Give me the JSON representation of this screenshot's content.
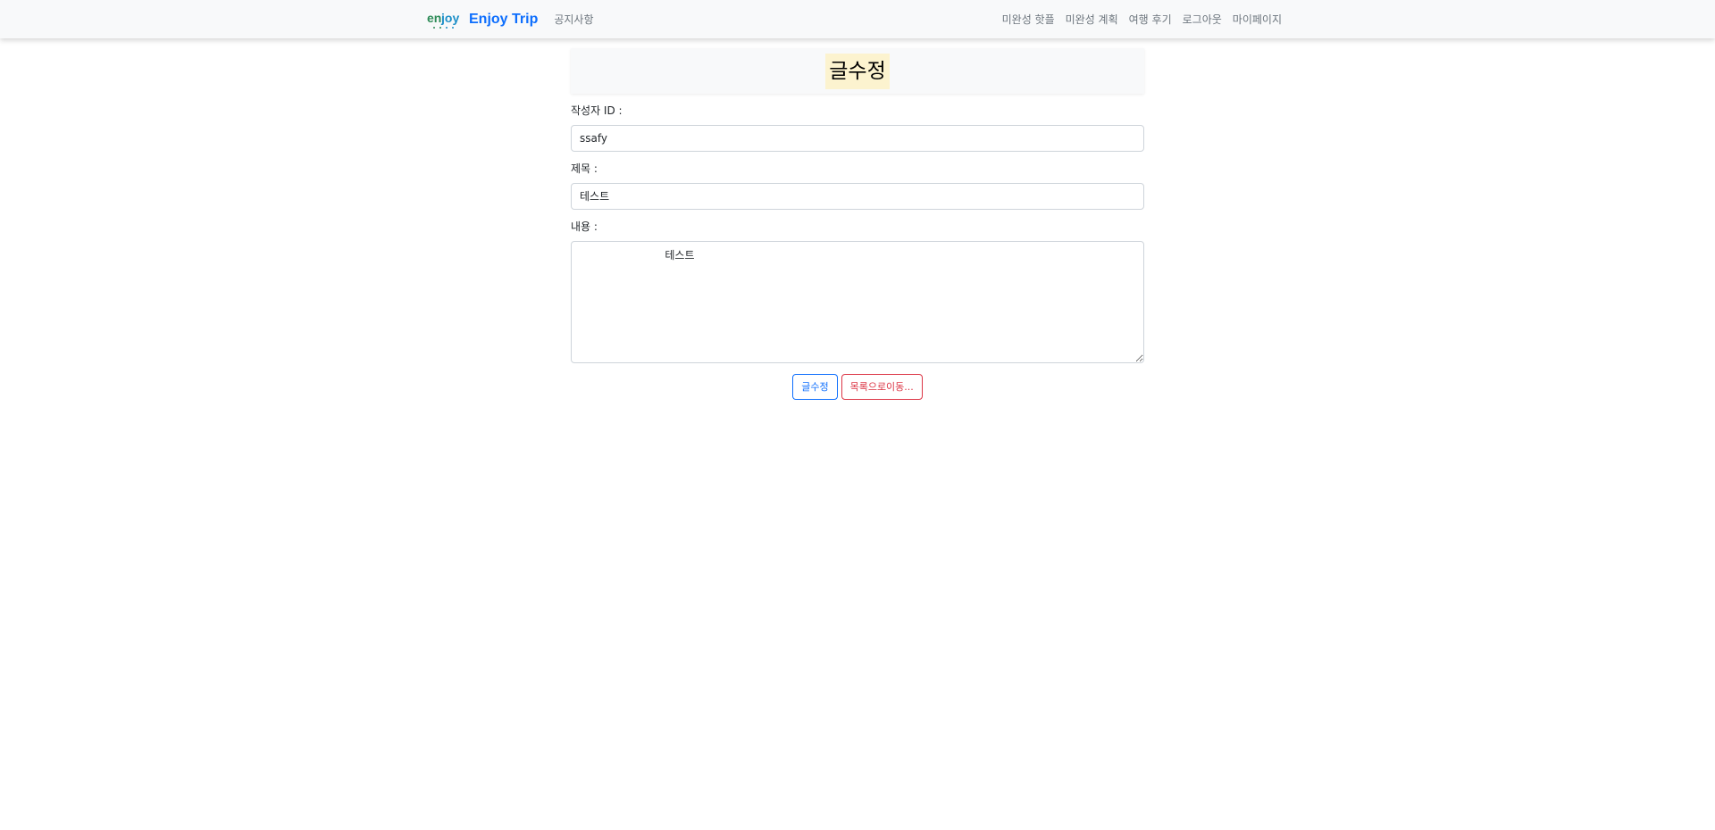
{
  "navbar": {
    "brand": "Enjoy Trip",
    "left_links": [
      "공지사항"
    ],
    "right_links": [
      "미완성 핫플",
      "미완성 계획",
      "여행 후기",
      "로그아웃",
      "마이페이지"
    ]
  },
  "page": {
    "title": "글수정"
  },
  "form": {
    "author_label": "작성자 ID :",
    "author_value": "ssafy",
    "subject_label": "제목 :",
    "subject_value": "테스트",
    "content_label": "내용 :",
    "content_value": "                         테스트"
  },
  "buttons": {
    "submit": "글수정",
    "list": "목록으로이동..."
  },
  "colors": {
    "primary": "#0d6efd",
    "danger": "#dc3545",
    "highlight": "#fcf3cf",
    "navbar_bg": "#f8f9fa"
  },
  "icons": {
    "logo": "enjoy-logo-icon"
  }
}
